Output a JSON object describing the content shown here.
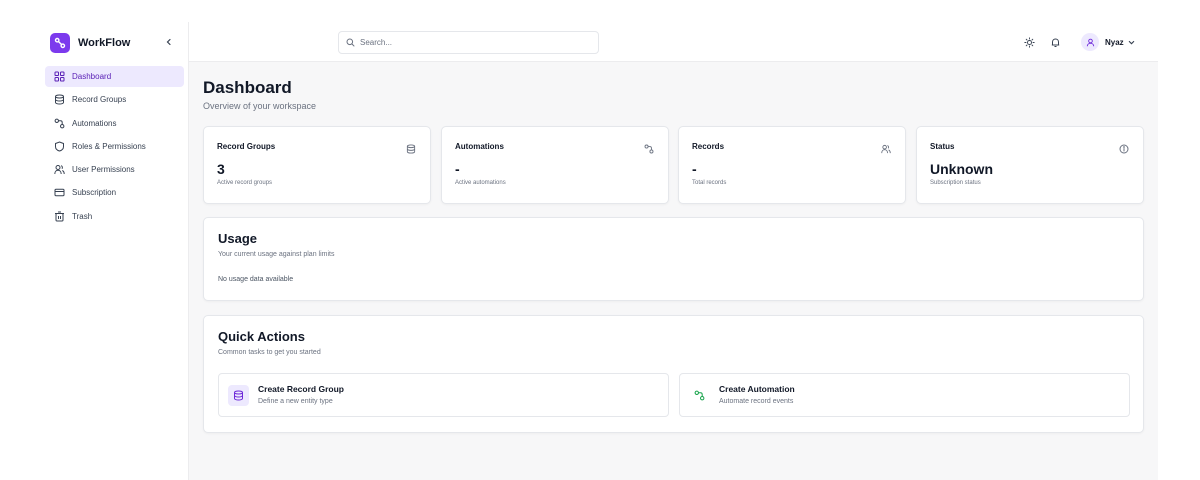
{
  "brand": {
    "name": "WorkFlow",
    "accent": "#7c3aed"
  },
  "sidebar": {
    "items": [
      {
        "label": "Dashboard",
        "icon": "grid-icon",
        "active": true
      },
      {
        "label": "Record Groups",
        "icon": "database-icon"
      },
      {
        "label": "Automations",
        "icon": "workflow-icon"
      },
      {
        "label": "Roles & Permissions",
        "icon": "shield-icon"
      },
      {
        "label": "User Permissions",
        "icon": "users-icon"
      },
      {
        "label": "Subscription",
        "icon": "credit-card-icon"
      },
      {
        "label": "Trash",
        "icon": "trash-icon"
      }
    ]
  },
  "header": {
    "search_placeholder": "Search...",
    "user_name": "Nyaz",
    "icons": [
      "sun-icon",
      "bell-icon",
      "user-icon",
      "chevron-down-icon"
    ]
  },
  "page": {
    "title": "Dashboard",
    "subtitle": "Overview of your workspace"
  },
  "stats": [
    {
      "title": "Record Groups",
      "value": "3",
      "caption": "Active record groups",
      "icon": "database-icon"
    },
    {
      "title": "Automations",
      "value": "-",
      "caption": "Active automations",
      "icon": "workflow-icon"
    },
    {
      "title": "Records",
      "value": "-",
      "caption": "Total records",
      "icon": "users-icon"
    },
    {
      "title": "Status",
      "value": "Unknown",
      "caption": "Subscription status",
      "icon": "info-icon"
    }
  ],
  "usage": {
    "title": "Usage",
    "subtitle": "Your current usage against plan limits",
    "empty": "No usage data available"
  },
  "quick_actions": {
    "title": "Quick Actions",
    "subtitle": "Common tasks to get you started",
    "items": [
      {
        "title": "Create Record Group",
        "description": "Define a new entity type",
        "icon": "database-icon"
      },
      {
        "title": "Create Automation",
        "description": "Automate record events",
        "icon": "workflow-icon"
      }
    ]
  },
  "colors": {
    "active_bg": "#ede9fe",
    "main_bg": "#f7f7f8",
    "automation_green": "#16a34a"
  }
}
